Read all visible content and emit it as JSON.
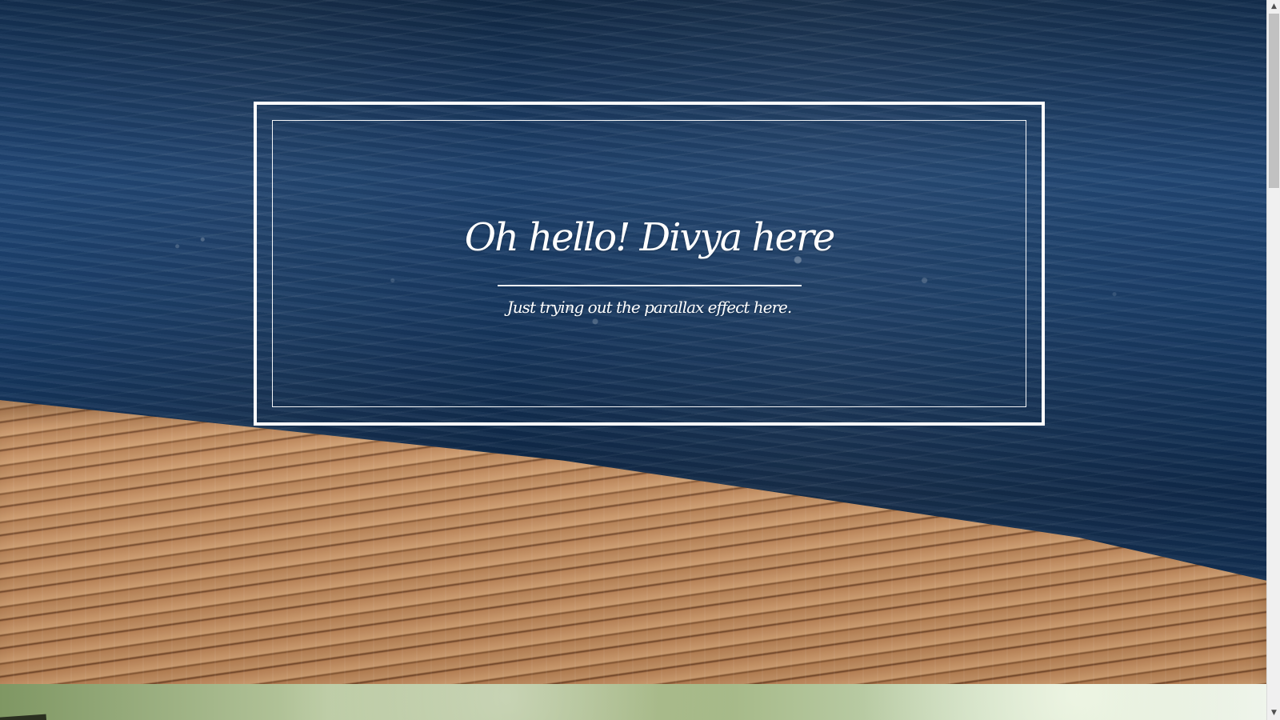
{
  "hero": {
    "title": "Oh hello! Divya here",
    "subtitle": "Just trying out the parallax effect here."
  },
  "scrollbar": {
    "up_icon": "▲",
    "down_icon": "▼"
  },
  "colors": {
    "frame": "#ffffff",
    "water_dark": "#102743",
    "water_mid": "#1e416c",
    "dock_wood": "#c79669",
    "scrollbar": "#f0f0f0",
    "scroll_thumb": "#c1c1c1"
  },
  "icons": {
    "scroll_up": "chevron-up-icon",
    "scroll_down": "chevron-down-icon"
  }
}
